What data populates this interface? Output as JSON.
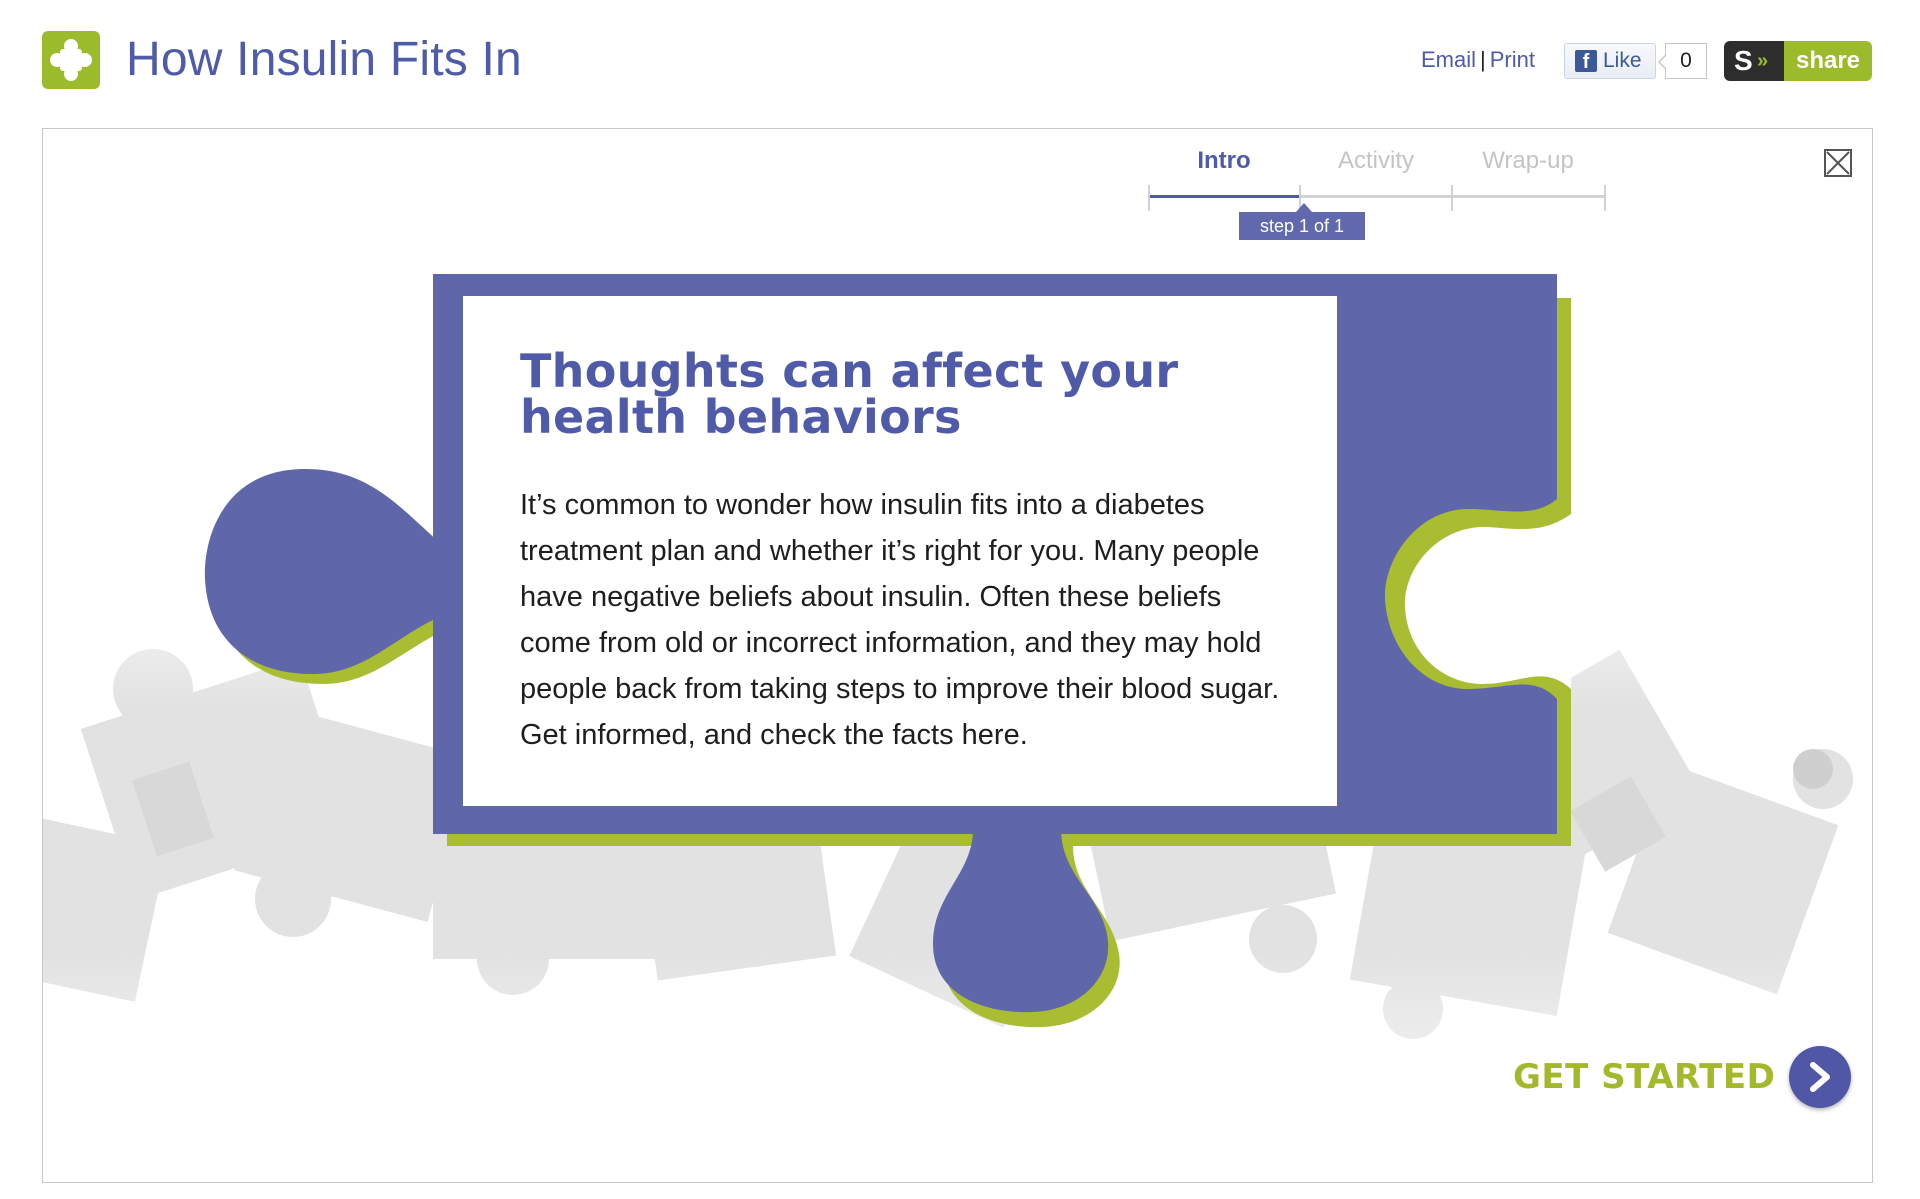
{
  "header": {
    "title": "How Insulin Fits In",
    "email_label": "Email",
    "separator": "|",
    "print_label": "Print",
    "fb_like_label": "Like",
    "fb_like_count": "0",
    "share_s_label": "S",
    "share_arrows": "»",
    "share_label": "share"
  },
  "steps": {
    "tabs": [
      {
        "label": "Intro",
        "state": "active"
      },
      {
        "label": "Activity",
        "state": "inactive"
      },
      {
        "label": "Wrap-up",
        "state": "inactive"
      }
    ],
    "badge": "step 1 of 1"
  },
  "card": {
    "title": "Thoughts can affect your health behaviors",
    "body": "It’s common to wonder how insulin fits into a diabetes treatment plan and whether it’s right for you. Many people have negative beliefs about insulin. Often these beliefs come from old or incorrect information, and they may hold people back from taking steps to improve their blood sugar. Get informed, and check the facts here."
  },
  "cta": {
    "label": "GET STARTED"
  },
  "colors": {
    "brand_blue": "#4f5aa8",
    "puzzle_blue": "#5f67aa",
    "accent_green": "#9cbb2c",
    "inactive_gray": "#c4c4c4"
  },
  "icons": {
    "logo": "puzzle-piece-icon",
    "close": "close-icon",
    "cta": "chevron-right-icon",
    "facebook": "facebook-icon"
  }
}
